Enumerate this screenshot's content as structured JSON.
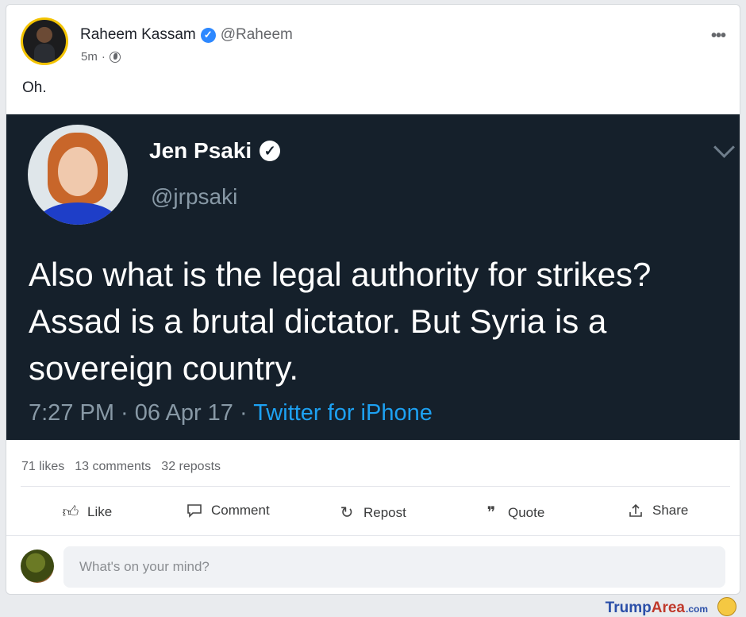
{
  "post": {
    "author_name": "Raheem Kassam",
    "author_handle": "@Raheem",
    "timestamp": "5m",
    "separator": "·",
    "text": "Oh.",
    "more_label": "•••"
  },
  "embedded_tweet": {
    "name": "Jen Psaki",
    "handle": "@jrpsaki",
    "text": "Also what is the legal authority for strikes? Assad is a brutal dictator. But Syria is a sovereign country.",
    "time": "7:27 PM · 06 Apr 17 · ",
    "source": "Twitter for iPhone"
  },
  "stats": {
    "likes": "71 likes",
    "comments": "13 comments",
    "reposts": "32 reposts"
  },
  "actions": {
    "like": "Like",
    "comment": "Comment",
    "repost": "Repost",
    "quote": "Quote",
    "share": "Share"
  },
  "composer": {
    "placeholder": "What's on your mind?"
  },
  "watermark": {
    "trump": "Trump",
    "area": "Area",
    "tld": ".com"
  },
  "colors": {
    "accent": "#2d88ff",
    "tweet_bg": "#15202b",
    "twitter_link": "#1da1f2"
  },
  "icons": [
    "globe-icon",
    "more-icon",
    "verified-icon",
    "chevron-down-icon",
    "like-icon",
    "comment-icon",
    "repost-icon",
    "quote-icon",
    "share-icon"
  ]
}
